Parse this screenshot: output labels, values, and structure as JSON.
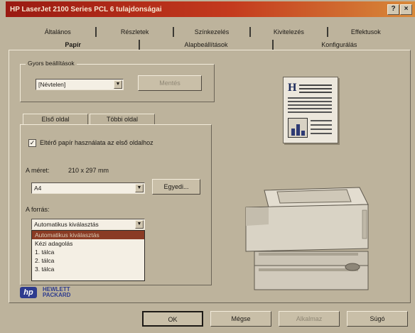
{
  "window": {
    "title": "HP LaserJet 2100 Series PCL 6 tulajdonságai",
    "help_btn": "?",
    "close_btn": "×"
  },
  "tabs_row1": [
    "Általános",
    "Részletek",
    "Színkezelés",
    "Kivitelezés",
    "Effektusok"
  ],
  "tabs_row2": [
    "Papír",
    "Alapbeállítások",
    "Konfigurálás"
  ],
  "quick_settings": {
    "label": "Gyors beállítások",
    "value": "[Névtelen]",
    "save_button": "Mentés"
  },
  "subtabs": [
    "Első oldal",
    "Többi oldal"
  ],
  "first_page": {
    "checkbox_label": "Eltérő papír használata az első oldalhoz",
    "checked": true,
    "size_label": "A méret:",
    "size_dims": "210 x 297 mm",
    "size_value": "A4",
    "custom_button": "Egyedi...",
    "source_label": "A forrás:",
    "source_value": "Automatikus kiválasztás",
    "source_options": [
      "Automatikus kiválasztás",
      "Kézi adagolás",
      "1. tálca",
      "2. tálca",
      "3. tálca"
    ],
    "source_selected_index": 0
  },
  "logo": {
    "line1": "HEWLETT",
    "line2": "PACKARD",
    "mark": "hp"
  },
  "buttons": {
    "ok": "OK",
    "cancel": "Mégse",
    "apply": "Alkalmaz",
    "help": "Súgó"
  },
  "colors": {
    "title_bar": "#b3281a",
    "selection": "#8a3b24",
    "window_bg": "#bdb39c"
  }
}
